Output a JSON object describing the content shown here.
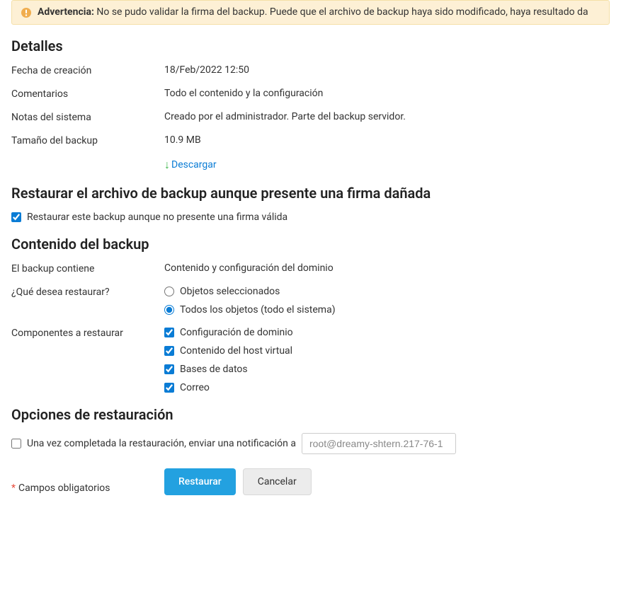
{
  "warning": {
    "label": "Advertencia:",
    "message": "No se pudo validar la firma del backup. Puede que el archivo de backup haya sido modificado, haya resultado da"
  },
  "sections": {
    "details": {
      "title": "Detalles",
      "creation_date_label": "Fecha de creación",
      "creation_date_value": "18/Feb/2022 12:50",
      "comments_label": "Comentarios",
      "comments_value": "Todo el contenido y la configuración",
      "system_notes_label": "Notas del sistema",
      "system_notes_value": "Creado por el administrador. Parte del backup servidor.",
      "backup_size_label": "Tamaño del backup",
      "backup_size_value": "10.9 MB",
      "download_label": "Descargar"
    },
    "restore_damaged": {
      "title": "Restaurar el archivo de backup aunque presente una firma dañada",
      "checkbox_label": "Restaurar este backup aunque no presente una firma válida"
    },
    "content": {
      "title": "Contenido del backup",
      "contains_label": "El backup contiene",
      "contains_value": "Contenido y configuración del dominio",
      "what_restore_label": "¿Qué desea restaurar?",
      "radio_selected": "Objetos seleccionados",
      "radio_all": "Todos los objetos (todo el sistema)",
      "components_label": "Componentes a restaurar",
      "comp_domain": "Configuración de dominio",
      "comp_vhost": "Contenido del host virtual",
      "comp_db": "Bases de datos",
      "comp_mail": "Correo"
    },
    "options": {
      "title": "Opciones de restauración",
      "notify_label": "Una vez completada la restauración, enviar una notificación a",
      "notify_value": "root@dreamy-shtern.217-76-1"
    }
  },
  "footer": {
    "required_label": "Campos obligatorios",
    "restore_button": "Restaurar",
    "cancel_button": "Cancelar"
  }
}
